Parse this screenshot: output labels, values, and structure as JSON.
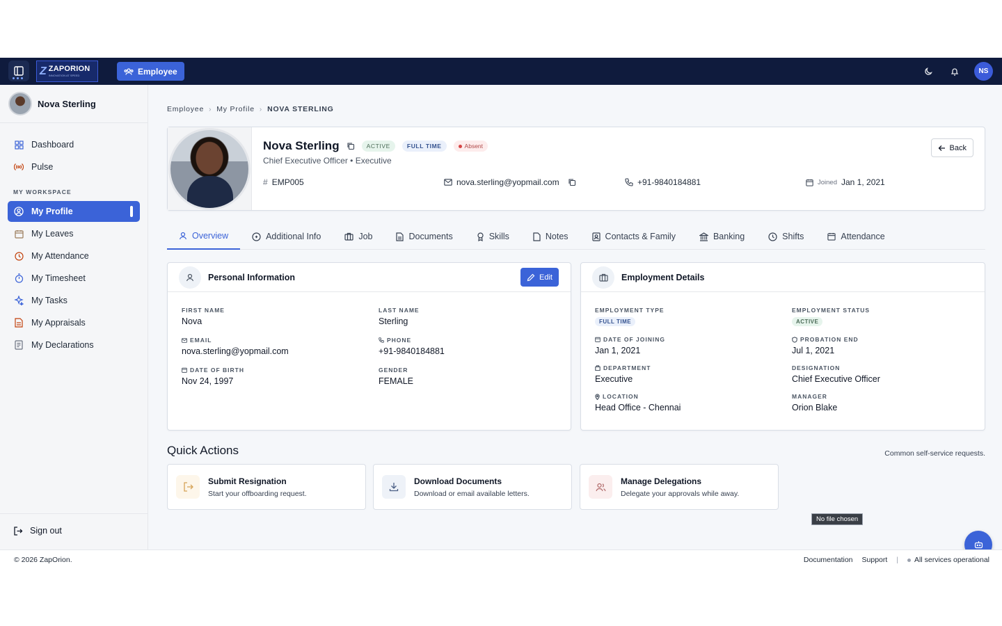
{
  "topbar": {
    "logo_text": "ZAPORION",
    "logo_tagline": "INNOVATION AT SPEED",
    "employee_button": "Employee",
    "avatar_initials": "NS"
  },
  "sidebar": {
    "user_name": "Nova Sterling",
    "items": [
      {
        "label": "Dashboard",
        "icon": "grid-icon"
      },
      {
        "label": "Pulse",
        "icon": "broadcast-icon"
      }
    ],
    "section_label": "MY WORKSPACE",
    "workspace_items": [
      {
        "label": "My Profile",
        "icon": "user-circle-icon",
        "active": true
      },
      {
        "label": "My Leaves",
        "icon": "calendar-icon"
      },
      {
        "label": "My Attendance",
        "icon": "clock-icon"
      },
      {
        "label": "My Timesheet",
        "icon": "stopwatch-icon"
      },
      {
        "label": "My Tasks",
        "icon": "sparkle-icon"
      },
      {
        "label": "My Appraisals",
        "icon": "document-icon"
      },
      {
        "label": "My Declarations",
        "icon": "receipt-icon"
      }
    ],
    "sign_out": "Sign out"
  },
  "breadcrumb": [
    "Employee",
    "My Profile",
    "NOVA STERLING"
  ],
  "profile": {
    "name": "Nova Sterling",
    "status_badge": "ACTIVE",
    "type_badge": "FULL TIME",
    "attendance_badge": "Absent",
    "subtitle": "Chief Executive Officer • Executive",
    "emp_id": "EMP005",
    "email": "nova.sterling@yopmail.com",
    "phone": "+91-9840184881",
    "joined_label": "Joined",
    "joined_date": "Jan 1, 2021",
    "back_label": "Back"
  },
  "tabs": [
    {
      "label": "Overview",
      "icon": "user-icon"
    },
    {
      "label": "Additional Info",
      "icon": "info-icon"
    },
    {
      "label": "Job",
      "icon": "briefcase-icon"
    },
    {
      "label": "Documents",
      "icon": "file-icon"
    },
    {
      "label": "Skills",
      "icon": "award-icon"
    },
    {
      "label": "Notes",
      "icon": "note-icon"
    },
    {
      "label": "Contacts & Family",
      "icon": "contacts-icon"
    },
    {
      "label": "Banking",
      "icon": "bank-icon"
    },
    {
      "label": "Shifts",
      "icon": "clock-icon"
    },
    {
      "label": "Attendance",
      "icon": "calendar-icon"
    }
  ],
  "personal": {
    "title": "Personal Information",
    "edit_label": "Edit",
    "first_name_label": "FIRST NAME",
    "first_name": "Nova",
    "last_name_label": "LAST NAME",
    "last_name": "Sterling",
    "email_label": "EMAIL",
    "email": "nova.sterling@yopmail.com",
    "phone_label": "PHONE",
    "phone": "+91-9840184881",
    "dob_label": "DATE OF BIRTH",
    "dob": "Nov 24, 1997",
    "gender_label": "GENDER",
    "gender": "FEMALE"
  },
  "employment": {
    "title": "Employment Details",
    "type_label": "EMPLOYMENT TYPE",
    "type": "FULL TIME",
    "status_label": "EMPLOYMENT STATUS",
    "status": "ACTIVE",
    "doj_label": "DATE OF JOINING",
    "doj": "Jan 1, 2021",
    "probation_label": "PROBATION END",
    "probation": "Jul 1, 2021",
    "department_label": "DEPARTMENT",
    "department": "Executive",
    "designation_label": "DESIGNATION",
    "designation": "Chief Executive Officer",
    "location_label": "LOCATION",
    "location": "Head Office - Chennai",
    "manager_label": "MANAGER",
    "manager": "Orion Blake"
  },
  "quick_actions": {
    "title": "Quick Actions",
    "note": "Common self-service requests.",
    "items": [
      {
        "title": "Submit Resignation",
        "subtitle": "Start your offboarding request.",
        "icon": "exit-icon"
      },
      {
        "title": "Download Documents",
        "subtitle": "Download or email available letters.",
        "icon": "download-icon"
      },
      {
        "title": "Manage Delegations",
        "subtitle": "Delegate your approvals while away.",
        "icon": "users-icon"
      }
    ]
  },
  "tooltip": "No file chosen",
  "footer": {
    "copyright": "© 2026 ZapOrion.",
    "documentation": "Documentation",
    "support": "Support",
    "status": "All services operational"
  },
  "colors": {
    "topbar": "#0f1b3d",
    "accent": "#3b63d8"
  }
}
